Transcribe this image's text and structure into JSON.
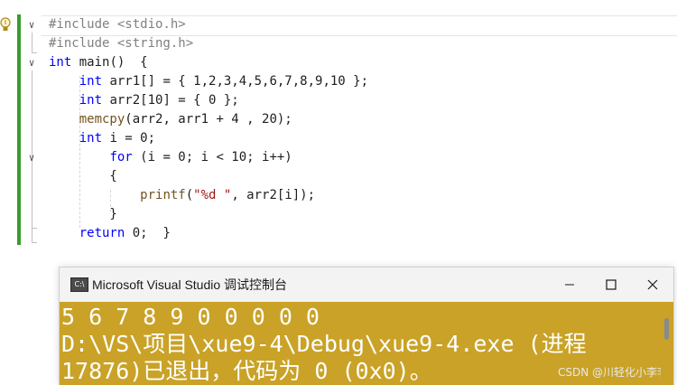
{
  "editor": {
    "lines": [
      {
        "parts": [
          {
            "t": "#include <stdio.h>",
            "c": "pp"
          }
        ]
      },
      {
        "parts": [
          {
            "t": "#include <string.h>",
            "c": "pp"
          }
        ]
      },
      {
        "parts": [
          {
            "t": "int",
            "c": "kw"
          },
          {
            "t": " main()  {",
            "c": ""
          }
        ]
      },
      {
        "parts": [
          {
            "t": "    ",
            "c": ""
          },
          {
            "t": "int",
            "c": "kw"
          },
          {
            "t": " arr1[] = { 1,2,3,4,5,6,7,8,9,10 };",
            "c": ""
          }
        ]
      },
      {
        "parts": [
          {
            "t": "    ",
            "c": ""
          },
          {
            "t": "int",
            "c": "kw"
          },
          {
            "t": " arr2[10] = { 0 };",
            "c": ""
          }
        ]
      },
      {
        "parts": [
          {
            "t": "    ",
            "c": ""
          },
          {
            "t": "memcpy",
            "c": "fn"
          },
          {
            "t": "(arr2, arr1 + 4 , 20);",
            "c": ""
          }
        ]
      },
      {
        "parts": [
          {
            "t": "    ",
            "c": ""
          },
          {
            "t": "int",
            "c": "kw"
          },
          {
            "t": " i = 0;",
            "c": ""
          }
        ]
      },
      {
        "parts": [
          {
            "t": "        ",
            "c": ""
          },
          {
            "t": "for",
            "c": "kw"
          },
          {
            "t": " (i = 0; i < 10; i++)",
            "c": ""
          }
        ]
      },
      {
        "parts": [
          {
            "t": "        {",
            "c": ""
          }
        ]
      },
      {
        "parts": [
          {
            "t": "            ",
            "c": ""
          },
          {
            "t": "printf",
            "c": "fn"
          },
          {
            "t": "(",
            "c": ""
          },
          {
            "t": "\"%d \"",
            "c": "str"
          },
          {
            "t": ", arr2[i]);",
            "c": ""
          }
        ]
      },
      {
        "parts": [
          {
            "t": "        }",
            "c": ""
          }
        ]
      },
      {
        "parts": [
          {
            "t": "    ",
            "c": ""
          },
          {
            "t": "return",
            "c": "kw"
          },
          {
            "t": " 0;  }",
            "c": ""
          }
        ]
      }
    ]
  },
  "console": {
    "title": "Microsoft Visual Studio 调试控制台",
    "icon_label": "C:\\",
    "output": [
      "5 6 7 8 9 0 0 0 0 0",
      "D:\\VS\\项目\\xue9-4\\Debug\\xue9-4.exe (进程",
      "17876)已退出，代码为 0 (0x0)。"
    ],
    "bg_color": "#c9a227"
  },
  "watermark": "CSDN @川轻化小李李"
}
